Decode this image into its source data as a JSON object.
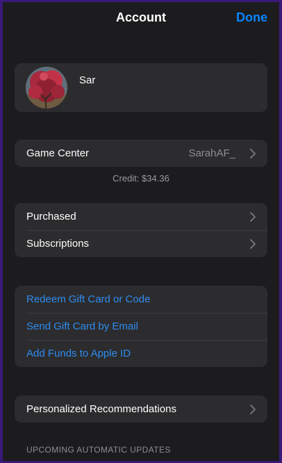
{
  "nav": {
    "title": "Account",
    "done_label": "Done"
  },
  "profile": {
    "name": "Sar"
  },
  "game_center": {
    "label": "Game Center",
    "value": "SarahAF_"
  },
  "credit": "Credit: $34.36",
  "purchases": {
    "items": [
      {
        "label": "Purchased"
      },
      {
        "label": "Subscriptions"
      }
    ]
  },
  "gift": {
    "items": [
      {
        "label": "Redeem Gift Card or Code"
      },
      {
        "label": "Send Gift Card by Email"
      },
      {
        "label": "Add Funds to Apple ID"
      }
    ]
  },
  "recommendations": {
    "label": "Personalized Recommendations"
  },
  "updates": {
    "header": "UPCOMING AUTOMATIC UPDATES"
  },
  "colors": {
    "accent": "#0a84ff",
    "background": "#1c1c1e",
    "card": "#2c2c2e"
  }
}
